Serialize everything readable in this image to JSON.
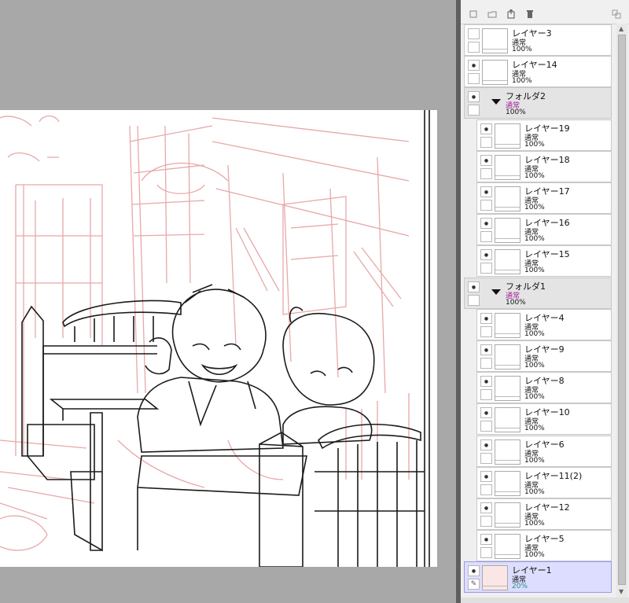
{
  "layers_panel": {
    "toolbar": {
      "icons": [
        "new-layer-icon",
        "new-folder-icon",
        "export-layer-icon",
        "trash-icon",
        "merge-layer-icon"
      ]
    },
    "layers": [
      {
        "name": "レイヤー3",
        "mode": "通常",
        "opacity": "100%",
        "visible": false,
        "folder": false,
        "indent": 0
      },
      {
        "name": "レイヤー14",
        "mode": "通常",
        "opacity": "100%",
        "visible": true,
        "folder": false,
        "indent": 0
      },
      {
        "name": "フォルダ2",
        "mode": "通常",
        "opacity": "100%",
        "visible": true,
        "folder": true,
        "indent": 0
      },
      {
        "name": "レイヤー19",
        "mode": "通常",
        "opacity": "100%",
        "visible": true,
        "folder": false,
        "indent": 1
      },
      {
        "name": "レイヤー18",
        "mode": "通常",
        "opacity": "100%",
        "visible": true,
        "folder": false,
        "indent": 1
      },
      {
        "name": "レイヤー17",
        "mode": "通常",
        "opacity": "100%",
        "visible": true,
        "folder": false,
        "indent": 1
      },
      {
        "name": "レイヤー16",
        "mode": "通常",
        "opacity": "100%",
        "visible": true,
        "folder": false,
        "indent": 1
      },
      {
        "name": "レイヤー15",
        "mode": "通常",
        "opacity": "100%",
        "visible": true,
        "folder": false,
        "indent": 1
      },
      {
        "name": "フォルダ1",
        "mode": "通常",
        "opacity": "100%",
        "visible": true,
        "folder": true,
        "indent": 0
      },
      {
        "name": "レイヤー4",
        "mode": "通常",
        "opacity": "100%",
        "visible": true,
        "folder": false,
        "indent": 1
      },
      {
        "name": "レイヤー9",
        "mode": "通常",
        "opacity": "100%",
        "visible": true,
        "folder": false,
        "indent": 1
      },
      {
        "name": "レイヤー8",
        "mode": "通常",
        "opacity": "100%",
        "visible": true,
        "folder": false,
        "indent": 1
      },
      {
        "name": "レイヤー10",
        "mode": "通常",
        "opacity": "100%",
        "visible": true,
        "folder": false,
        "indent": 1
      },
      {
        "name": "レイヤー6",
        "mode": "通常",
        "opacity": "100%",
        "visible": true,
        "folder": false,
        "indent": 1
      },
      {
        "name": "レイヤー11(2)",
        "mode": "通常",
        "opacity": "100%",
        "visible": true,
        "folder": false,
        "indent": 1
      },
      {
        "name": "レイヤー12",
        "mode": "通常",
        "opacity": "100%",
        "visible": true,
        "folder": false,
        "indent": 1
      },
      {
        "name": "レイヤー5",
        "mode": "通常",
        "opacity": "100%",
        "visible": true,
        "folder": false,
        "indent": 1
      },
      {
        "name": "レイヤー1",
        "mode": "通常",
        "opacity": "20%",
        "visible": true,
        "folder": false,
        "indent": 0,
        "selected": true
      }
    ]
  },
  "colors": {
    "sketch_red": "#e8a8a8",
    "line_black": "#1a1a1a",
    "canvas_bg": "#a8a8a8",
    "selected_row": "#ddddff",
    "folder_mode": "#a0209a"
  }
}
